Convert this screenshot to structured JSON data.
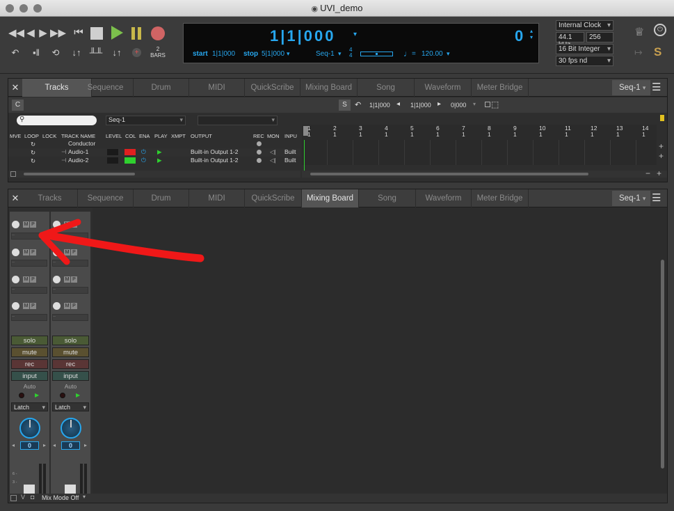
{
  "window": {
    "title": "UVI_demo"
  },
  "transport": {
    "counter_main": "1|1|000",
    "counter_right": "0",
    "start_label": "start",
    "start_value": "1|1|000",
    "stop_label": "stop",
    "stop_value": "5|1|000",
    "sequence": "Seq-1",
    "meter_top": "4",
    "meter_bottom": "4",
    "tempo_sign": "=",
    "tempo": "120.00",
    "bars_label": "2",
    "bars_unit": "BARS",
    "clock": "Internal Clock",
    "sample_rate": "44.1 kHz",
    "buffer": "256",
    "bit_depth": "16 Bit Integer",
    "fps": "30 fps nd",
    "s_button": "S"
  },
  "upper_panel": {
    "close": "✕",
    "tabs": [
      "Tracks",
      "Sequence",
      "Drum",
      "MIDI",
      "QuickScribe",
      "Mixing Board",
      "Song",
      "Waveform",
      "Meter Bridge"
    ],
    "active_tab": "Tracks",
    "seq_select": "Seq-1",
    "c_button": "C",
    "search_placeholder": "",
    "seq_field": "Seq-1",
    "s_button": "S",
    "loc1": "1|1|000",
    "loc2": "1|1|000",
    "loc3": "0|000",
    "columns": [
      "MVE",
      "LOOP",
      "LOCK",
      "TRACK NAME",
      "LEVEL",
      "COL",
      "ENA",
      "PLAY",
      "XMPT",
      "OUTPUT",
      "REC",
      "MON",
      "INPU"
    ],
    "tracks": [
      {
        "name": "Conductor",
        "output": "",
        "input": ""
      },
      {
        "name": "Audio-1",
        "output": "Built-in Output 1-2",
        "input": "Built"
      },
      {
        "name": "Audio-2",
        "output": "Built-in Output 1-2",
        "input": "Built"
      }
    ],
    "ruler_bars": [
      "1",
      "2",
      "3",
      "4",
      "5",
      "6",
      "7",
      "8",
      "9",
      "10",
      "11",
      "12",
      "13",
      "14"
    ],
    "ruler_beat": "1",
    "plus": "+",
    "minus": "−"
  },
  "lower_panel": {
    "close": "✕",
    "tabs": [
      "Tracks",
      "Sequence",
      "Drum",
      "MIDI",
      "QuickScribe",
      "Mixing Board",
      "Song",
      "Waveform",
      "Meter Bridge"
    ],
    "active_tab": "Mixing Board",
    "seq_select": "Seq-1",
    "channels": [
      {
        "solo": "solo",
        "mute": "mute",
        "rec": "rec",
        "input": "input",
        "auto": "Auto",
        "mode": "Latch",
        "pan": "0"
      },
      {
        "solo": "solo",
        "mute": "mute",
        "rec": "rec",
        "input": "input",
        "auto": "Auto",
        "mode": "Latch",
        "pan": "0"
      }
    ],
    "insert_m": "M",
    "insert_p": "P",
    "slot_dash": "--",
    "fader_marks": [
      "6 -",
      "3 -"
    ],
    "mix_mode": "Mix Mode Off"
  },
  "colors": {
    "accent": "#27a7ef",
    "audio1": "#e02020",
    "audio2": "#2fd02f",
    "annotation": "#f01818"
  }
}
